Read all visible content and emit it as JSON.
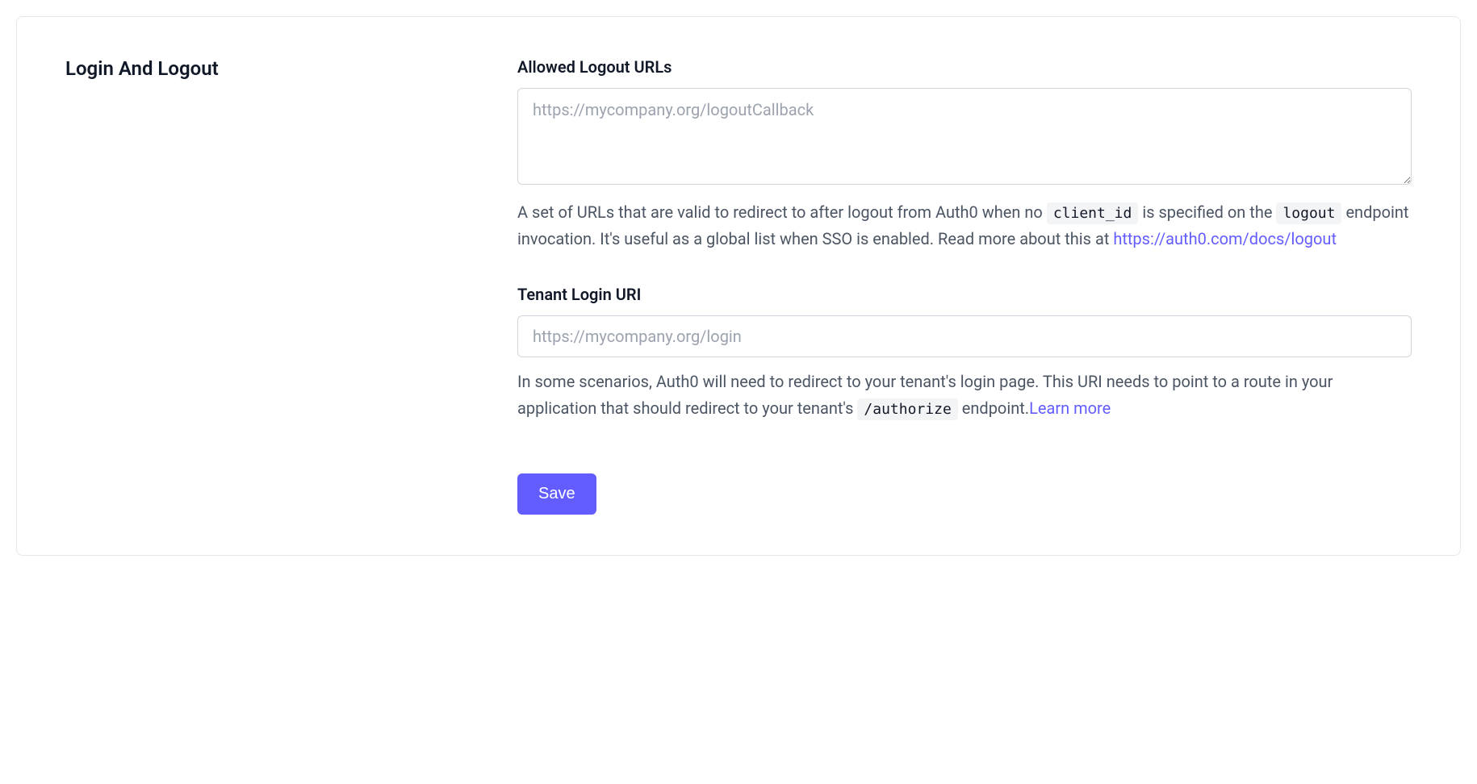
{
  "section": {
    "title": "Login And Logout"
  },
  "fields": {
    "logout_urls": {
      "label": "Allowed Logout URLs",
      "placeholder": "https://mycompany.org/logoutCallback",
      "value": "",
      "help_pre": "A set of URLs that are valid to redirect to after logout from Auth0 when no ",
      "help_code1": "client_id",
      "help_mid1": " is specified on the ",
      "help_code2": "logout",
      "help_post": " endpoint invocation. It's useful as a global list when SSO is enabled. Read more about this at ",
      "help_link": "https://auth0.com/docs/logout"
    },
    "tenant_login_uri": {
      "label": "Tenant Login URI",
      "placeholder": "https://mycompany.org/login",
      "value": "",
      "help_pre": "In some scenarios, Auth0 will need to redirect to your tenant's login page. This URI needs to point to a route in your application that should redirect to your tenant's ",
      "help_code": "/authorize",
      "help_post": " endpoint.",
      "help_link": "Learn more"
    }
  },
  "actions": {
    "save_label": "Save"
  }
}
